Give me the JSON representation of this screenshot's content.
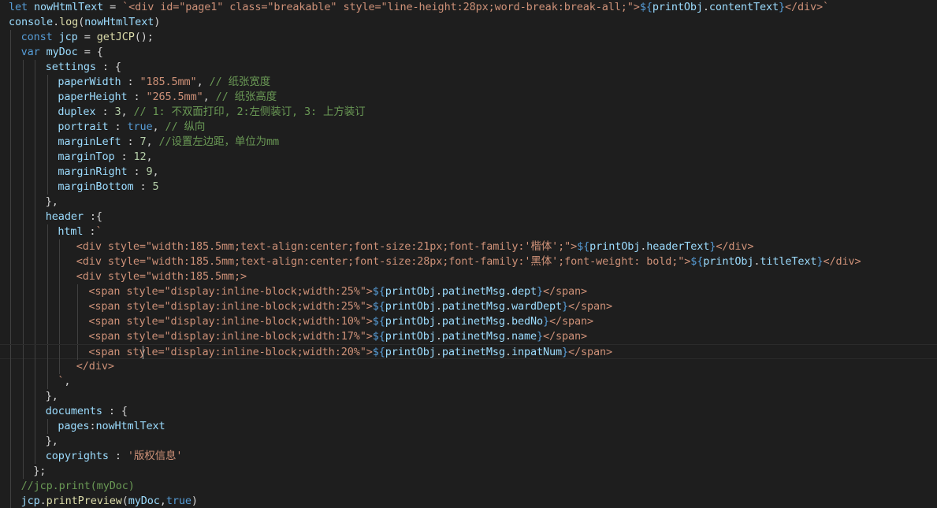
{
  "editor": {
    "background": "#1e1e1e",
    "colors": {
      "kw": "#569cd6",
      "id": "#9cdcfe",
      "fn": "#dcdcaa",
      "str": "#ce9178",
      "num": "#b5cea8",
      "cm": "#6a9955",
      "pn": "#d4d4d4",
      "tpl": "#569cd6"
    },
    "lines": [
      {
        "i": 0,
        "t": [
          [
            "kw",
            "let"
          ],
          [
            "pn",
            " "
          ],
          [
            "id",
            "nowHtmlText"
          ],
          [
            "pn",
            " = "
          ],
          [
            "str",
            "`<div id=\"page1\" class=\"breakable\" style=\"line-height:28px;word-break:break-all;\">"
          ],
          [
            "tpl",
            "${"
          ],
          [
            "id",
            "printObj"
          ],
          [
            "pn",
            "."
          ],
          [
            "id",
            "contentText"
          ],
          [
            "tpl",
            "}"
          ],
          [
            "str",
            "</div>`"
          ]
        ]
      },
      {
        "i": 0,
        "t": [
          [
            "id",
            "console"
          ],
          [
            "pn",
            "."
          ],
          [
            "fn",
            "log"
          ],
          [
            "pn",
            "("
          ],
          [
            "id",
            "nowHtmlText"
          ],
          [
            "pn",
            ")"
          ]
        ]
      },
      {
        "i": 1,
        "t": [
          [
            "kw",
            "const"
          ],
          [
            "pn",
            " "
          ],
          [
            "id",
            "jcp"
          ],
          [
            "pn",
            " = "
          ],
          [
            "fn",
            "getJCP"
          ],
          [
            "pn",
            "();"
          ]
        ]
      },
      {
        "i": 1,
        "t": [
          [
            "kw",
            "var"
          ],
          [
            "pn",
            " "
          ],
          [
            "id",
            "myDoc"
          ],
          [
            "pn",
            " = {"
          ]
        ]
      },
      {
        "i": 3,
        "t": [
          [
            "id",
            "settings"
          ],
          [
            "pn",
            " : {"
          ]
        ]
      },
      {
        "i": 4,
        "t": [
          [
            "id",
            "paperWidth"
          ],
          [
            "pn",
            " : "
          ],
          [
            "str",
            "\"185.5mm\""
          ],
          [
            "pn",
            ", "
          ],
          [
            "cm",
            "// 纸张宽度"
          ]
        ]
      },
      {
        "i": 4,
        "t": [
          [
            "id",
            "paperHeight"
          ],
          [
            "pn",
            " : "
          ],
          [
            "str",
            "\"265.5mm\""
          ],
          [
            "pn",
            ", "
          ],
          [
            "cm",
            "// 纸张高度"
          ]
        ]
      },
      {
        "i": 4,
        "t": [
          [
            "id",
            "duplex"
          ],
          [
            "pn",
            " : "
          ],
          [
            "num",
            "3"
          ],
          [
            "pn",
            ", "
          ],
          [
            "cm",
            "// 1: 不双面打印, 2:左侧装订, 3: 上方装订"
          ]
        ]
      },
      {
        "i": 4,
        "t": [
          [
            "id",
            "portrait"
          ],
          [
            "pn",
            " : "
          ],
          [
            "kw",
            "true"
          ],
          [
            "pn",
            ", "
          ],
          [
            "cm",
            "// 纵向"
          ]
        ]
      },
      {
        "i": 4,
        "t": [
          [
            "id",
            "marginLeft"
          ],
          [
            "pn",
            " : "
          ],
          [
            "num",
            "7"
          ],
          [
            "pn",
            ", "
          ],
          [
            "cm",
            "//设置左边距，单位为mm"
          ]
        ]
      },
      {
        "i": 4,
        "t": [
          [
            "id",
            "marginTop"
          ],
          [
            "pn",
            " : "
          ],
          [
            "num",
            "12"
          ],
          [
            "pn",
            ","
          ]
        ]
      },
      {
        "i": 4,
        "t": [
          [
            "id",
            "marginRight"
          ],
          [
            "pn",
            " : "
          ],
          [
            "num",
            "9"
          ],
          [
            "pn",
            ","
          ]
        ]
      },
      {
        "i": 4,
        "t": [
          [
            "id",
            "marginBottom"
          ],
          [
            "pn",
            " : "
          ],
          [
            "num",
            "5"
          ]
        ]
      },
      {
        "i": 3,
        "t": [
          [
            "pn",
            "},"
          ]
        ]
      },
      {
        "i": 3,
        "t": [
          [
            "id",
            "header"
          ],
          [
            "pn",
            " :{"
          ]
        ]
      },
      {
        "i": 4,
        "t": [
          [
            "id",
            "html"
          ],
          [
            "pn",
            " :"
          ],
          [
            "str",
            "`"
          ]
        ]
      },
      {
        "i": 5.5,
        "t": [
          [
            "str",
            "<div style=\"width:185.5mm;text-align:center;font-size:21px;font-family:'楷体';\">"
          ],
          [
            "tpl",
            "${"
          ],
          [
            "id",
            "printObj"
          ],
          [
            "pn",
            "."
          ],
          [
            "id",
            "headerText"
          ],
          [
            "tpl",
            "}"
          ],
          [
            "str",
            "</div>"
          ]
        ]
      },
      {
        "i": 5.5,
        "t": [
          [
            "str",
            "<div style=\"width:185.5mm;text-align:center;font-size:28px;font-family:'黑体';font-weight: bold;\">"
          ],
          [
            "tpl",
            "${"
          ],
          [
            "id",
            "printObj"
          ],
          [
            "pn",
            "."
          ],
          [
            "id",
            "titleText"
          ],
          [
            "tpl",
            "}"
          ],
          [
            "str",
            "</div>"
          ]
        ]
      },
      {
        "i": 5.5,
        "t": [
          [
            "str",
            "<div style=\"width:185.5mm;>"
          ]
        ]
      },
      {
        "i": 6.5,
        "t": [
          [
            "str",
            "<span style=\"display:inline-block;width:25%\">"
          ],
          [
            "tpl",
            "${"
          ],
          [
            "id",
            "printObj"
          ],
          [
            "pn",
            "."
          ],
          [
            "id",
            "patinetMsg"
          ],
          [
            "pn",
            "."
          ],
          [
            "id",
            "dept"
          ],
          [
            "tpl",
            "}"
          ],
          [
            "str",
            "</span>"
          ]
        ]
      },
      {
        "i": 6.5,
        "t": [
          [
            "str",
            "<span style=\"display:inline-block;width:25%\">"
          ],
          [
            "tpl",
            "${"
          ],
          [
            "id",
            "printObj"
          ],
          [
            "pn",
            "."
          ],
          [
            "id",
            "patinetMsg"
          ],
          [
            "pn",
            "."
          ],
          [
            "id",
            "wardDept"
          ],
          [
            "tpl",
            "}"
          ],
          [
            "str",
            "</span>"
          ]
        ]
      },
      {
        "i": 6.5,
        "t": [
          [
            "str",
            "<span style=\"display:inline-block;width:10%\">"
          ],
          [
            "tpl",
            "${"
          ],
          [
            "id",
            "printObj"
          ],
          [
            "pn",
            "."
          ],
          [
            "id",
            "patinetMsg"
          ],
          [
            "pn",
            "."
          ],
          [
            "id",
            "bedNo"
          ],
          [
            "tpl",
            "}"
          ],
          [
            "str",
            "</span>"
          ]
        ]
      },
      {
        "i": 6.5,
        "t": [
          [
            "str",
            "<span style=\"display:inline-block;width:17%\">"
          ],
          [
            "tpl",
            "${"
          ],
          [
            "id",
            "printObj"
          ],
          [
            "pn",
            "."
          ],
          [
            "id",
            "patinetMsg"
          ],
          [
            "pn",
            "."
          ],
          [
            "id",
            "name"
          ],
          [
            "tpl",
            "}"
          ],
          [
            "str",
            "</span>"
          ]
        ]
      },
      {
        "i": 6.5,
        "t": [
          [
            "str",
            "<span style=\"display:inline-block;width:20%\">"
          ],
          [
            "tpl",
            "${"
          ],
          [
            "id",
            "printObj"
          ],
          [
            "pn",
            "."
          ],
          [
            "id",
            "patinetMsg"
          ],
          [
            "pn",
            "."
          ],
          [
            "id",
            "inpatNum"
          ],
          [
            "tpl",
            "}"
          ],
          [
            "str",
            "</span>"
          ]
        ],
        "current": true
      },
      {
        "i": 5.5,
        "t": [
          [
            "str",
            "</div>"
          ]
        ]
      },
      {
        "i": 4,
        "t": [
          [
            "str",
            "`"
          ],
          [
            "pn",
            ","
          ]
        ]
      },
      {
        "i": 3,
        "t": [
          [
            "pn",
            "},"
          ]
        ]
      },
      {
        "i": 3,
        "t": [
          [
            "id",
            "documents"
          ],
          [
            "pn",
            " : {"
          ]
        ]
      },
      {
        "i": 4,
        "t": [
          [
            "id",
            "pages"
          ],
          [
            "pn",
            ":"
          ],
          [
            "id",
            "nowHtmlText"
          ]
        ]
      },
      {
        "i": 3,
        "t": [
          [
            "pn",
            "},"
          ]
        ]
      },
      {
        "i": 3,
        "t": [
          [
            "id",
            "copyrights"
          ],
          [
            "pn",
            " : "
          ],
          [
            "str",
            "'版权信息'"
          ]
        ]
      },
      {
        "i": 2,
        "t": [
          [
            "pn",
            "};"
          ]
        ]
      },
      {
        "i": 1,
        "t": [
          [
            "cm",
            "//jcp.print(myDoc)"
          ]
        ]
      },
      {
        "i": 1,
        "t": [
          [
            "id",
            "jcp"
          ],
          [
            "pn",
            "."
          ],
          [
            "fn",
            "printPreview"
          ],
          [
            "pn",
            "("
          ],
          [
            "id",
            "myDoc"
          ],
          [
            "pn",
            ","
          ],
          [
            "kw",
            "true"
          ],
          [
            "pn",
            ")"
          ]
        ]
      }
    ]
  }
}
